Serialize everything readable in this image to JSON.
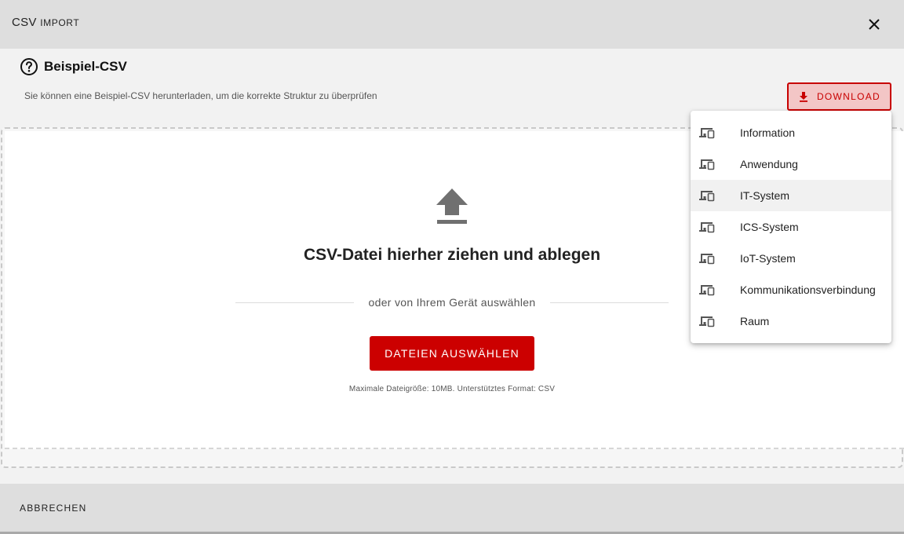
{
  "dialog": {
    "title_first": "CSV",
    "title_second": "Import"
  },
  "example": {
    "title": "Beispiel-CSV",
    "description": "Sie können eine Beispiel-CSV herunterladen, um die korrekte Struktur zu überprüfen",
    "download_label": "DOWNLOAD"
  },
  "dropzone": {
    "title": "CSV-Datei hierher ziehen und ablegen",
    "divider_text": "oder von Ihrem Gerät auswählen",
    "select_label": "DATEIEN AUSWÄHLEN",
    "hint": "Maximale Dateigröße: 10MB. Unterstütztes Format: CSV"
  },
  "menu": {
    "items": [
      {
        "label": "Information",
        "icon": "devices-icon"
      },
      {
        "label": "Anwendung",
        "icon": "devices-icon"
      },
      {
        "label": "IT-System",
        "icon": "devices-icon",
        "highlighted": true
      },
      {
        "label": "ICS-System",
        "icon": "devices-icon"
      },
      {
        "label": "IoT-System",
        "icon": "devices-icon"
      },
      {
        "label": "Kommunikationsverbindung",
        "icon": "devices-icon"
      },
      {
        "label": "Raum",
        "icon": "devices-icon"
      }
    ]
  },
  "footer": {
    "cancel_label": "ABBRECHEN"
  },
  "colors": {
    "accent": "#cc0000",
    "header_bg": "#dedede"
  }
}
